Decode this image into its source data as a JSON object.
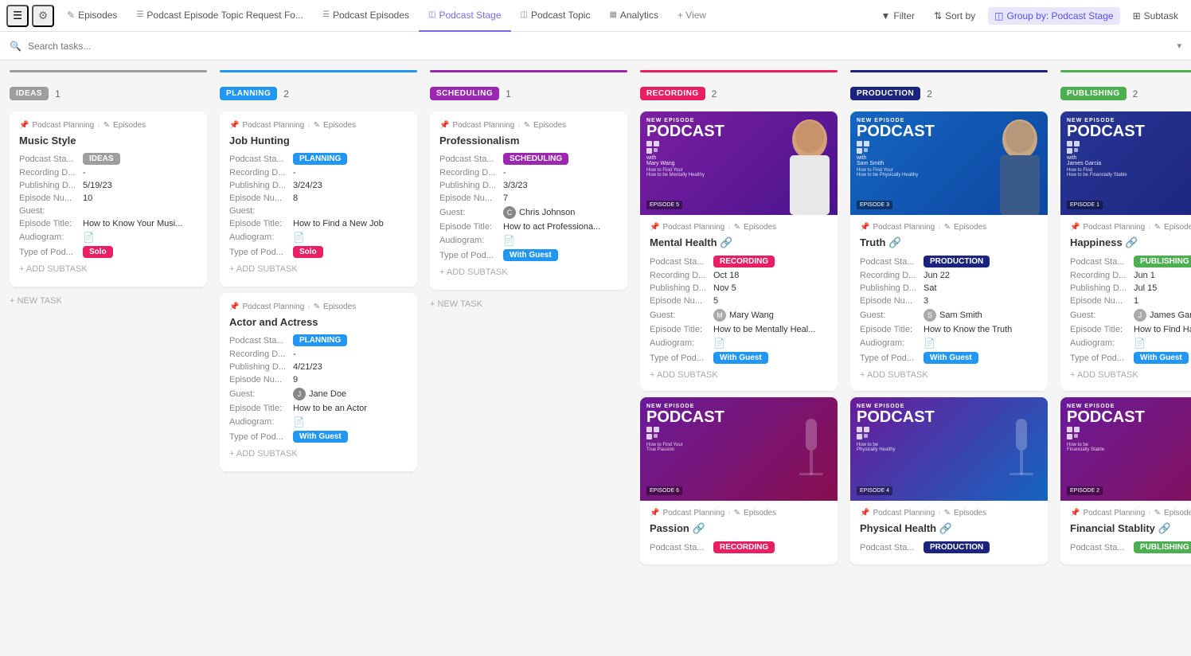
{
  "topbar": {
    "menu_icon": "☰",
    "settings_icon": "⚙",
    "tabs": [
      {
        "label": "Episodes",
        "icon": "✎",
        "active": false
      },
      {
        "label": "Podcast Episode Topic Request Fo...",
        "icon": "☰",
        "active": false
      },
      {
        "label": "Podcast Episodes",
        "icon": "☰",
        "active": false
      },
      {
        "label": "Podcast Stage",
        "icon": "◫",
        "active": true
      },
      {
        "label": "Podcast Topic",
        "icon": "◫",
        "active": false
      },
      {
        "label": "Analytics",
        "icon": "▦",
        "active": false
      },
      {
        "label": "+ View",
        "icon": "",
        "active": false
      }
    ],
    "filter_label": "Filter",
    "sort_label": "Sort by",
    "group_by_label": "Group by: Podcast Stage",
    "subtask_label": "Subtask"
  },
  "search": {
    "placeholder": "Search tasks...",
    "dropdown": "▾"
  },
  "columns": [
    {
      "id": "ideas",
      "label": "IDEAS",
      "count": "1",
      "color": "#9e9e9e",
      "bar_class": "bar-ideas",
      "badge_class": "badge-ideas",
      "cards": [
        {
          "type": "simple",
          "breadcrumb": "Podcast Planning > Episodes",
          "title": "Music Style",
          "fields": [
            {
              "label": "Podcast Sta...",
              "type": "badge",
              "value": "IDEAS",
              "badge_class": "badge-ideas"
            },
            {
              "label": "Recording D...",
              "type": "text",
              "value": "-"
            },
            {
              "label": "Publishing D...",
              "type": "text",
              "value": "5/19/23"
            },
            {
              "label": "Episode Nu...",
              "type": "text",
              "value": "10"
            },
            {
              "label": "Guest:",
              "type": "text",
              "value": ""
            },
            {
              "label": "Episode Title:",
              "type": "text",
              "value": "How to Know Your Musi..."
            },
            {
              "label": "Audiogram:",
              "type": "file",
              "value": ""
            },
            {
              "label": "Type of Pod...",
              "type": "badge",
              "value": "Solo",
              "badge_class": "badge-solo"
            }
          ],
          "add_subtask": "+ ADD SUBTASK",
          "new_task": "+ NEW TASK"
        }
      ]
    },
    {
      "id": "planning",
      "label": "PLANNING",
      "count": "2",
      "color": "#2196f3",
      "bar_class": "bar-planning",
      "badge_class": "badge-planning",
      "cards": [
        {
          "type": "simple",
          "breadcrumb": "Podcast Planning > Episodes",
          "title": "Job Hunting",
          "fields": [
            {
              "label": "Podcast Sta...",
              "type": "badge",
              "value": "PLANNING",
              "badge_class": "badge-planning"
            },
            {
              "label": "Recording D...",
              "type": "text",
              "value": "-"
            },
            {
              "label": "Publishing D...",
              "type": "text",
              "value": "3/24/23"
            },
            {
              "label": "Episode Nu...",
              "type": "text",
              "value": "8"
            },
            {
              "label": "Guest:",
              "type": "text",
              "value": ""
            },
            {
              "label": "Episode Title:",
              "type": "text",
              "value": "How to Find a New Job"
            },
            {
              "label": "Audiogram:",
              "type": "file",
              "value": ""
            },
            {
              "label": "Type of Pod...",
              "type": "badge",
              "value": "Solo",
              "badge_class": "badge-solo"
            }
          ],
          "add_subtask": "+ ADD SUBTASK"
        },
        {
          "type": "simple",
          "breadcrumb": "Podcast Planning > Episodes",
          "title": "Actor and Actress",
          "fields": [
            {
              "label": "Podcast Sta...",
              "type": "badge",
              "value": "PLANNING",
              "badge_class": "badge-planning"
            },
            {
              "label": "Recording D...",
              "type": "text",
              "value": "-"
            },
            {
              "label": "Publishing D...",
              "type": "text",
              "value": "4/21/23"
            },
            {
              "label": "Episode Nu...",
              "type": "text",
              "value": "9"
            },
            {
              "label": "Guest:",
              "type": "guest",
              "value": "Jane Doe",
              "color": "#888"
            },
            {
              "label": "Episode Title:",
              "type": "text",
              "value": "How to be an Actor"
            },
            {
              "label": "Audiogram:",
              "type": "file",
              "value": ""
            },
            {
              "label": "Type of Pod...",
              "type": "badge",
              "value": "With Guest",
              "badge_class": "badge-withguest"
            }
          ],
          "add_subtask": "+ ADD SUBTASK"
        }
      ]
    },
    {
      "id": "scheduling",
      "label": "SCHEDULING",
      "count": "1",
      "color": "#9c27b0",
      "bar_class": "bar-scheduling",
      "badge_class": "badge-scheduling",
      "cards": [
        {
          "type": "simple",
          "breadcrumb": "Podcast Planning > Episodes",
          "title": "Professionalism",
          "fields": [
            {
              "label": "Podcast Sta...",
              "type": "badge",
              "value": "SCHEDULING",
              "badge_class": "badge-scheduling"
            },
            {
              "label": "Recording D...",
              "type": "text",
              "value": "-"
            },
            {
              "label": "Publishing D...",
              "type": "text",
              "value": "3/3/23"
            },
            {
              "label": "Episode Nu...",
              "type": "text",
              "value": "7"
            },
            {
              "label": "Guest:",
              "type": "guest",
              "value": "Chris Johnson",
              "color": "#888"
            },
            {
              "label": "Episode Title:",
              "type": "text",
              "value": "How to act Professiona..."
            },
            {
              "label": "Audiogram:",
              "type": "file",
              "value": ""
            },
            {
              "label": "Type of Pod...",
              "type": "badge",
              "value": "With Guest",
              "badge_class": "badge-withguest"
            }
          ],
          "add_subtask": "+ ADD SUBTASK",
          "new_task": "+ NEW TASK"
        }
      ]
    },
    {
      "id": "recording",
      "label": "RECORDING",
      "count": "2",
      "color": "#e91e63",
      "bar_class": "bar-recording",
      "badge_class": "badge-recording",
      "cards": [
        {
          "type": "image",
          "image_style": "pc-purple",
          "image_person": "mary",
          "episode_label": "EPISODE 5",
          "breadcrumb": "Podcast Planning > Episodes",
          "title": "Mental Health",
          "title_suffix": "🔗",
          "fields": [
            {
              "label": "Podcast Sta...",
              "type": "badge",
              "value": "RECORDING",
              "badge_class": "badge-recording"
            },
            {
              "label": "Recording D...",
              "type": "text",
              "value": "Oct 18"
            },
            {
              "label": "Publishing D...",
              "type": "text",
              "value": "Nov 5"
            },
            {
              "label": "Episode Nu...",
              "type": "text",
              "value": "5"
            },
            {
              "label": "Guest:",
              "type": "guest",
              "value": "Mary Wang",
              "color": "#888"
            },
            {
              "label": "Episode Title:",
              "type": "text",
              "value": "How to be Mentally Heal..."
            },
            {
              "label": "Audiogram:",
              "type": "file",
              "value": ""
            },
            {
              "label": "Type of Pod...",
              "type": "badge",
              "value": "With Guest",
              "badge_class": "badge-withguest"
            }
          ],
          "add_subtask": "+ ADD SUBTASK",
          "subtitle": "with\nMary Wang\nHow to Find Your\nHow to be Mentally Healthy"
        },
        {
          "type": "image",
          "image_style": "pc-mic",
          "image_person": "mic",
          "episode_label": "EPISODE 6",
          "breadcrumb": "Podcast Planning > Episodes",
          "title": "Passion",
          "title_suffix": "🔗",
          "fields": [
            {
              "label": "Podcast Sta...",
              "type": "badge",
              "value": "RECORDING",
              "badge_class": "badge-recording"
            }
          ],
          "add_subtask": ""
        }
      ]
    },
    {
      "id": "production",
      "label": "PRODUCTION",
      "count": "2",
      "color": "#1a237e",
      "bar_class": "bar-production",
      "badge_class": "badge-production",
      "cards": [
        {
          "type": "image",
          "image_style": "pc-blue",
          "image_person": "sam",
          "episode_label": "EPISODE 3",
          "breadcrumb": "Podcast Planning > Episodes",
          "title": "Truth",
          "title_suffix": "🔗",
          "fields": [
            {
              "label": "Podcast Sta...",
              "type": "badge",
              "value": "PRODUCTION",
              "badge_class": "badge-production"
            },
            {
              "label": "Recording D...",
              "type": "text",
              "value": "Jun 22"
            },
            {
              "label": "Publishing D...",
              "type": "text",
              "value": "Sat"
            },
            {
              "label": "Episode Nu...",
              "type": "text",
              "value": "3"
            },
            {
              "label": "Guest:",
              "type": "guest",
              "value": "Sam Smith",
              "color": "#888"
            },
            {
              "label": "Episode Title:",
              "type": "text",
              "value": "How to Know the Truth"
            },
            {
              "label": "Audiogram:",
              "type": "file",
              "value": ""
            },
            {
              "label": "Type of Pod...",
              "type": "badge",
              "value": "With Guest",
              "badge_class": "badge-withguest"
            }
          ],
          "add_subtask": "+ ADD SUBTASK",
          "subtitle": "with\nSam Smith\nHow to Find Your\nHow to be Physically Healthy"
        },
        {
          "type": "image",
          "image_style": "pc-mic",
          "image_person": "mic",
          "episode_label": "EPISODE 4",
          "breadcrumb": "Podcast Planning > Episodes",
          "title": "Physical Health",
          "title_suffix": "🔗",
          "fields": [
            {
              "label": "Podcast Sta...",
              "type": "badge",
              "value": "PRODUCTION",
              "badge_class": "badge-production"
            }
          ],
          "add_subtask": ""
        }
      ]
    },
    {
      "id": "publishing",
      "label": "PUBLISHING",
      "count": "2",
      "color": "#4caf50",
      "bar_class": "bar-publishing",
      "badge_class": "badge-publishing",
      "cards": [
        {
          "type": "image",
          "image_style": "pc-darkblue",
          "image_person": "james",
          "episode_label": "EPISODE 1",
          "breadcrumb": "Podcast Planning > Episodes",
          "title": "Happiness",
          "title_suffix": "🔗",
          "fields": [
            {
              "label": "Podcast Sta...",
              "type": "badge",
              "value": "PUBLISHING",
              "badge_class": "badge-publishing"
            },
            {
              "label": "Recording D...",
              "type": "text",
              "value": "Jun 1"
            },
            {
              "label": "Publishing D...",
              "type": "text",
              "value": "Jul 15"
            },
            {
              "label": "Episode Nu...",
              "type": "text",
              "value": "1"
            },
            {
              "label": "Guest:",
              "type": "guest",
              "value": "James Garcia",
              "color": "#888"
            },
            {
              "label": "Episode Title:",
              "type": "text",
              "value": "How to Find Happiness"
            },
            {
              "label": "Audiogram:",
              "type": "file",
              "value": ""
            },
            {
              "label": "Type of Pod...",
              "type": "badge",
              "value": "With Guest",
              "badge_class": "badge-withguest"
            }
          ],
          "add_subtask": "+ ADD SUBTASK",
          "subtitle": "with\nJames Garcia\nHow to Find\nHow to be Financially Stable"
        },
        {
          "type": "image",
          "image_style": "pc-mic",
          "image_person": "mic",
          "episode_label": "EPISODE 2",
          "breadcrumb": "Podcast Planning > Episodes",
          "title": "Financial Stablity",
          "title_suffix": "🔗",
          "fields": [
            {
              "label": "Podcast Sta...",
              "type": "badge",
              "value": "PUBLISHING",
              "badge_class": "badge-publishing"
            }
          ],
          "add_subtask": ""
        }
      ]
    }
  ]
}
